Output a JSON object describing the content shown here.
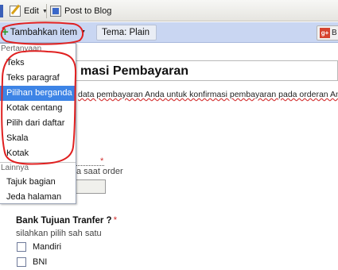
{
  "toolbar": {
    "edit_label": "Edit",
    "post_label": "Post to Blog"
  },
  "editor": {
    "add_item_label": "Tambahkan item",
    "theme_label": "Tema:  Plain",
    "gplus_label": "B"
  },
  "form": {
    "title": "masi Pembayaran",
    "description": "data pembayaran Anda untuk konfirmasi pembayaran pada orderan And",
    "help_text_1": "a saat order",
    "question": {
      "title": "Bank Tujuan Tranfer ?",
      "required_mark": "*",
      "help": "silahkan pilih sah satu",
      "options": [
        "Mandiri",
        "BNI"
      ]
    }
  },
  "menu": {
    "section_1": "Pertanyaan",
    "items_1": [
      "Teks",
      "Teks paragraf",
      "Pilihan berganda",
      "Kotak centang",
      "Pilih dari daftar",
      "Skala",
      "Kotak"
    ],
    "selected": "Pilihan berganda",
    "section_2": "Lainnya",
    "items_2": [
      "Tajuk bagian",
      "Jeda halaman"
    ]
  },
  "colors": {
    "editor_bar": "#c9d6f2",
    "menu_selected": "#3d84e6",
    "annotation": "#e02020",
    "required": "#d23030"
  }
}
